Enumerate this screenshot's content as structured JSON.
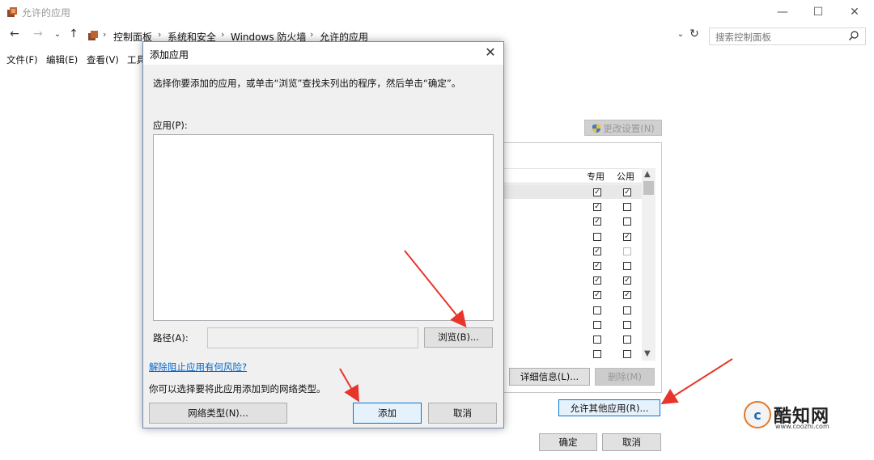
{
  "window": {
    "title": "允许的应用",
    "controls": [
      "—",
      "☐",
      "✕"
    ]
  },
  "address": {
    "crumbs": [
      "控制面板",
      "系统和安全",
      "Windows 防火墙",
      "允许的应用"
    ],
    "search_placeholder": "搜索控制面板"
  },
  "menu": [
    "文件(F)",
    "编辑(E)",
    "查看(V)",
    "工具"
  ],
  "background": {
    "change_settings_label": "更改设置(N)",
    "col_private": "专用",
    "col_public": "公用",
    "rows": [
      {
        "private": true,
        "public": true,
        "public_faint": false
      },
      {
        "private": true,
        "public": false,
        "public_faint": false
      },
      {
        "private": true,
        "public": false,
        "public_faint": false
      },
      {
        "private": false,
        "public": true,
        "public_faint": false
      },
      {
        "private": true,
        "public": false,
        "public_faint": true
      },
      {
        "private": true,
        "public": false,
        "public_faint": false
      },
      {
        "private": true,
        "public": true,
        "public_faint": false
      },
      {
        "private": true,
        "public": true,
        "public_faint": false
      },
      {
        "private": false,
        "public": false,
        "public_faint": false
      },
      {
        "private": false,
        "public": false,
        "public_faint": false
      },
      {
        "private": false,
        "public": false,
        "public_faint": false
      },
      {
        "private": false,
        "public": false,
        "public_faint": false
      }
    ],
    "details_label": "详细信息(L)...",
    "remove_label": "删除(M)",
    "allow_other_label": "允许其他应用(R)...",
    "ok_label": "确定",
    "cancel_label": "取消"
  },
  "dialog": {
    "title": "添加应用",
    "instruction": "选择你要添加的应用，或单击“浏览”查找未列出的程序，然后单击“确定”。",
    "apps_label": "应用(P):",
    "path_label": "路径(A):",
    "path_value": "",
    "browse_label": "浏览(B)...",
    "risk_link": "解除阻止应用有何风险?",
    "network_note": "你可以选择要将此应用添加到的网络类型。",
    "network_types_label": "网络类型(N)...",
    "add_label": "添加",
    "cancel_label": "取消"
  },
  "watermark": {
    "name": "酷知网",
    "url": "www.coozhi.com"
  },
  "colors": {
    "link": "#0066cc",
    "annotation_arrow": "#e8352c",
    "focus_border": "#0078d7"
  }
}
